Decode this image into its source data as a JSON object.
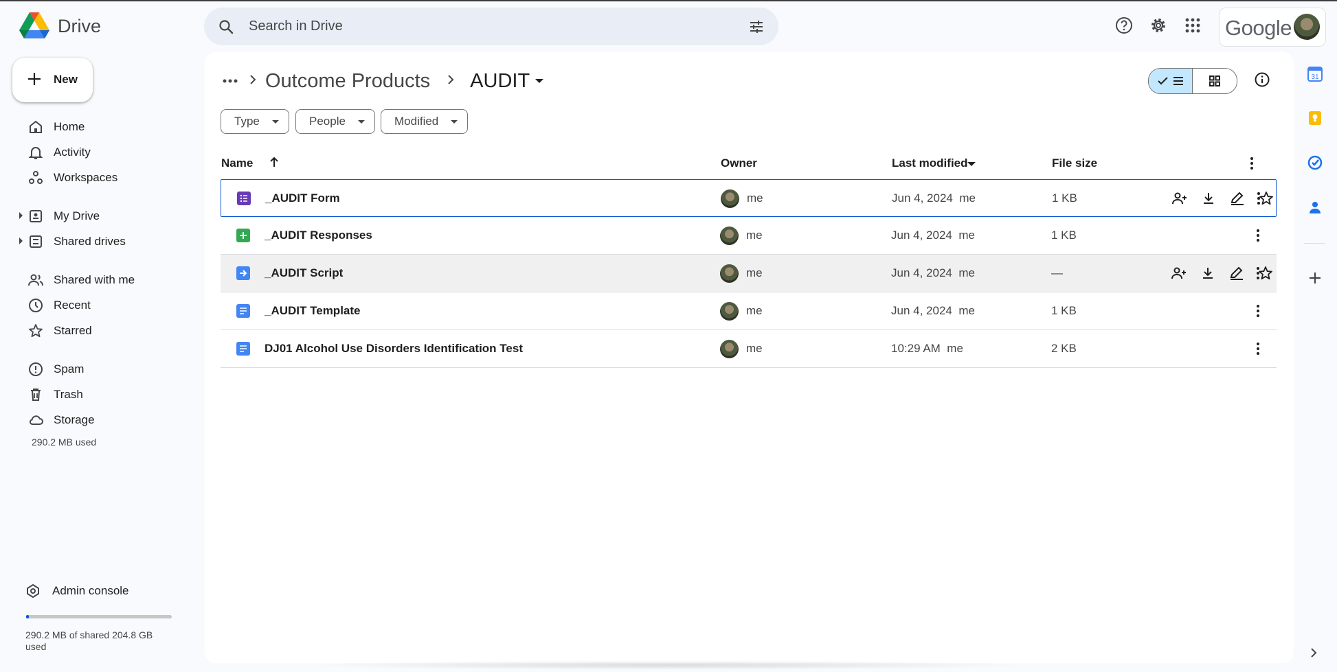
{
  "app": {
    "name": "Drive",
    "brand": "Google"
  },
  "search": {
    "placeholder": "Search in Drive"
  },
  "sidebar": {
    "new_label": "New",
    "items": [
      {
        "label": "Home",
        "icon": "home-icon"
      },
      {
        "label": "Activity",
        "icon": "bell-icon"
      },
      {
        "label": "Workspaces",
        "icon": "workspaces-icon"
      },
      {
        "label": "My Drive",
        "icon": "my-drive-icon"
      },
      {
        "label": "Shared drives",
        "icon": "shared-drives-icon"
      },
      {
        "label": "Shared with me",
        "icon": "people-icon"
      },
      {
        "label": "Recent",
        "icon": "clock-icon"
      },
      {
        "label": "Starred",
        "icon": "star-icon"
      },
      {
        "label": "Spam",
        "icon": "spam-icon"
      },
      {
        "label": "Trash",
        "icon": "trash-icon"
      },
      {
        "label": "Storage",
        "icon": "cloud-icon"
      }
    ],
    "storage_used_short": "290.2 MB used",
    "admin_console": "Admin console",
    "storage_fraction": 0.0014,
    "storage_detail": "290.2 MB of shared 204.8 GB used"
  },
  "breadcrumb": {
    "parent": "Outcome Products",
    "current": "AUDIT"
  },
  "filters": {
    "type": "Type",
    "people": "People",
    "modified": "Modified"
  },
  "table": {
    "headers": {
      "name": "Name",
      "owner": "Owner",
      "last_modified": "Last modified",
      "file_size": "File size"
    },
    "rows": [
      {
        "name": "_AUDIT Form",
        "owner": "me",
        "modified": "Jun 4, 2024",
        "modified_by": "me",
        "size": "1 KB",
        "type": "forms"
      },
      {
        "name": "_AUDIT Responses",
        "owner": "me",
        "modified": "Jun 4, 2024",
        "modified_by": "me",
        "size": "1 KB",
        "type": "sheets"
      },
      {
        "name": "_AUDIT Script",
        "owner": "me",
        "modified": "Jun 4, 2024",
        "modified_by": "me",
        "size": "—",
        "type": "script"
      },
      {
        "name": "_AUDIT Template",
        "owner": "me",
        "modified": "Jun 4, 2024",
        "modified_by": "me",
        "size": "1 KB",
        "type": "docs"
      },
      {
        "name": "DJ01 Alcohol Use Disorders Identification Test",
        "owner": "me",
        "modified": "10:29 AM",
        "modified_by": "me",
        "size": "2 KB",
        "type": "docs"
      }
    ]
  },
  "colors": {
    "forms": "#673ab7",
    "sheets": "#34a853",
    "script": "#4285f4",
    "docs": "#4285f4",
    "accent": "#0b57d0",
    "view_toggle_active": "#c2e7ff"
  },
  "right_rail": {
    "calendar_day": "31"
  }
}
